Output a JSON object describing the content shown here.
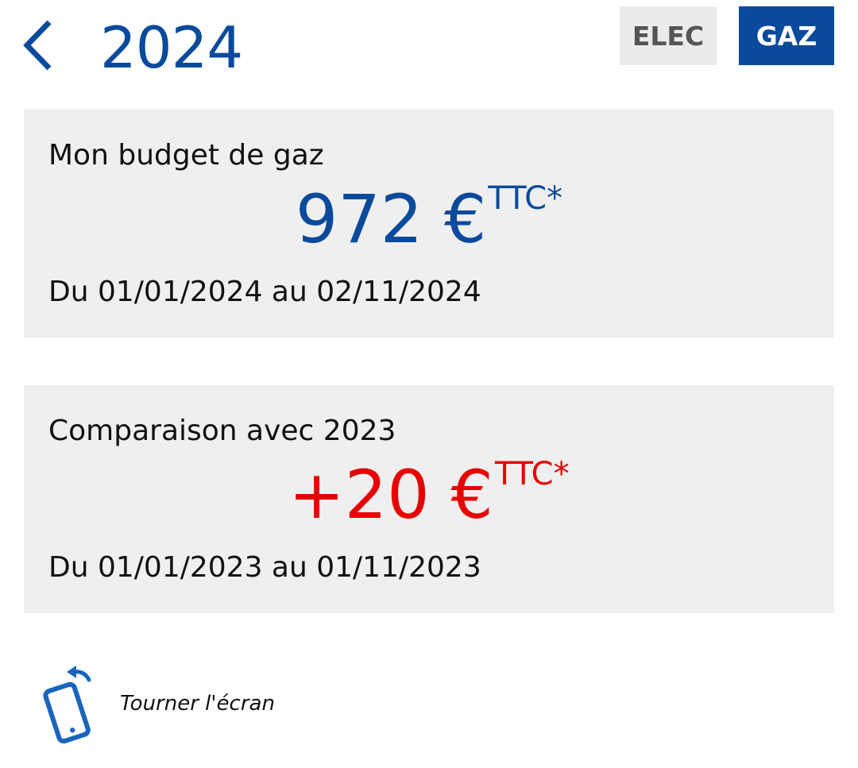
{
  "header": {
    "back_icon": "chevron-left-icon",
    "title": "2024",
    "toggles": [
      {
        "label": "ELEC",
        "selected": false
      },
      {
        "label": "GAZ",
        "selected": true
      }
    ]
  },
  "budget_card": {
    "label": "Mon budget de gaz",
    "amount": "972 €",
    "amount_suffix": "TTC*",
    "dates": "Du 01/01/2024 au 02/11/2024"
  },
  "comparison_card": {
    "label": "Comparaison avec 2023",
    "amount": "+20 €",
    "amount_suffix": "TTC*",
    "dates": "Du 01/01/2023 au 01/11/2023"
  },
  "rotate": {
    "icon": "rotate-phone-icon",
    "label": "Tourner l'écran"
  },
  "colors": {
    "brand_blue": "#0a4a9c",
    "increase_red": "#e60000",
    "card_bg": "#efefef",
    "toggle_inactive_bg": "#ebebeb"
  }
}
